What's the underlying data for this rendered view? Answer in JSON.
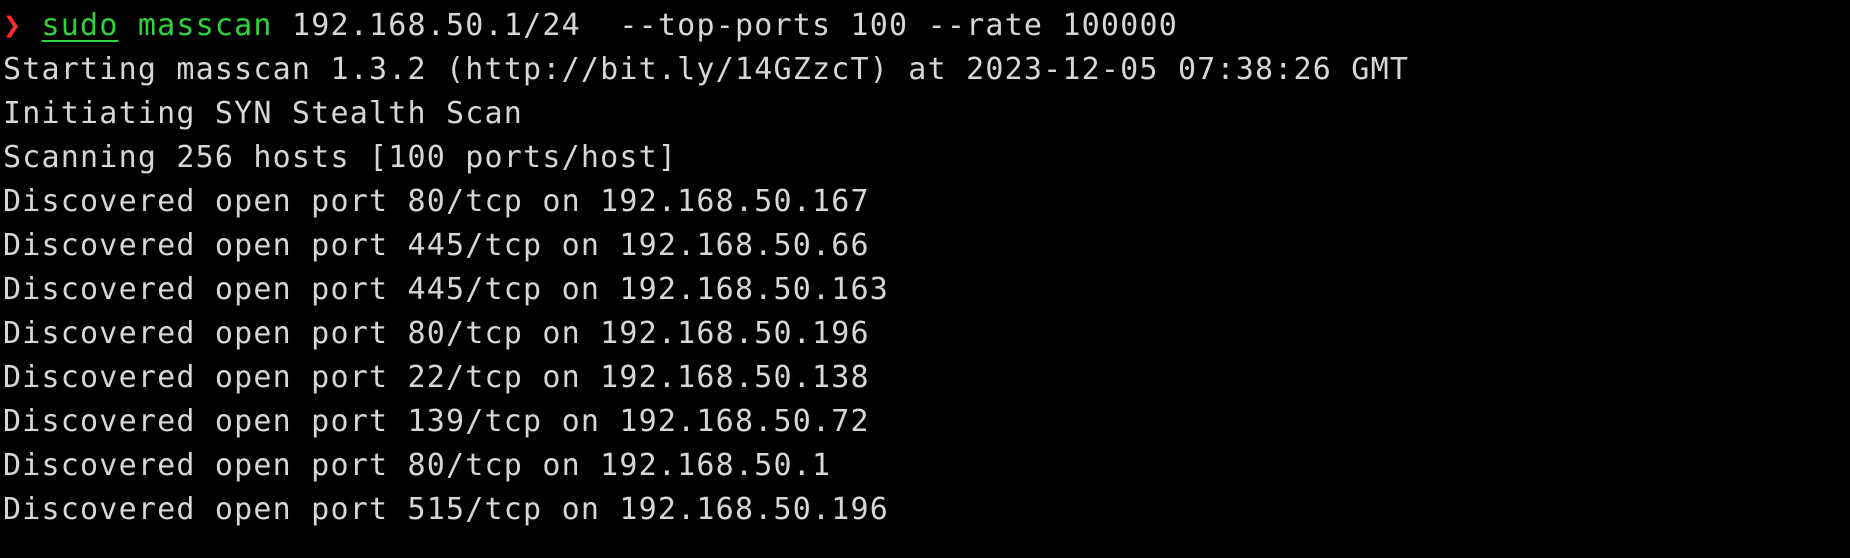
{
  "prompt": {
    "symbol": "❯",
    "sudo": "sudo",
    "command": "masscan",
    "args": "192.168.50.1/24  --top-ports 100 --rate 100000"
  },
  "output": [
    "Starting masscan 1.3.2 (http://bit.ly/14GZzcT) at 2023-12-05 07:38:26 GMT",
    "Initiating SYN Stealth Scan",
    "Scanning 256 hosts [100 ports/host]",
    "Discovered open port 80/tcp on 192.168.50.167",
    "Discovered open port 445/tcp on 192.168.50.66",
    "Discovered open port 445/tcp on 192.168.50.163",
    "Discovered open port 80/tcp on 192.168.50.196",
    "Discovered open port 22/tcp on 192.168.50.138",
    "Discovered open port 139/tcp on 192.168.50.72",
    "Discovered open port 80/tcp on 192.168.50.1",
    "Discovered open port 515/tcp on 192.168.50.196"
  ],
  "colors": {
    "background": "#000000",
    "text": "#d6d6d6",
    "prompt": "#ff2b2b",
    "command": "#2fd33a"
  }
}
